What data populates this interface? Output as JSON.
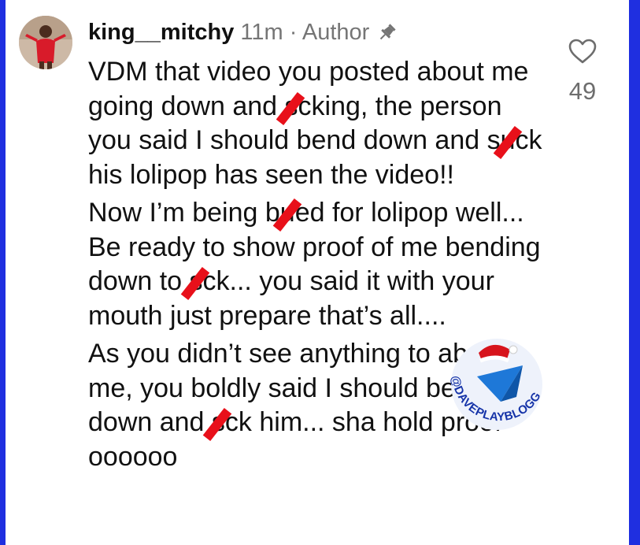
{
  "comment": {
    "author": "king__mitchy",
    "time": "11m",
    "separator": "·",
    "role": "Author",
    "paragraphs": [
      [
        "VDM that video you posted about me going down and s",
        "cking, the person you said I should bend down and su",
        "ck his lolipop has seen the video!!"
      ],
      [
        "Now I’m being bu",
        "ed for lolipop well...  Be ready to show proof of me bending down to s",
        "ck...  you said it with your mouth just prepare that’s all...."
      ],
      [
        "As you didn’t see anything to about me, you boldly said I should bend down and s",
        "ck him... sha hold proof oooooo"
      ]
    ]
  },
  "like": {
    "count": "49"
  },
  "icons": {
    "pin": "pin-icon",
    "like": "heart-outline-icon"
  },
  "watermark": {
    "text": "@DAVEPLAYBLOGGER"
  },
  "colors": {
    "frame": "#1f2fe0",
    "redaction": "#e8101a",
    "meta_text": "#757575"
  }
}
